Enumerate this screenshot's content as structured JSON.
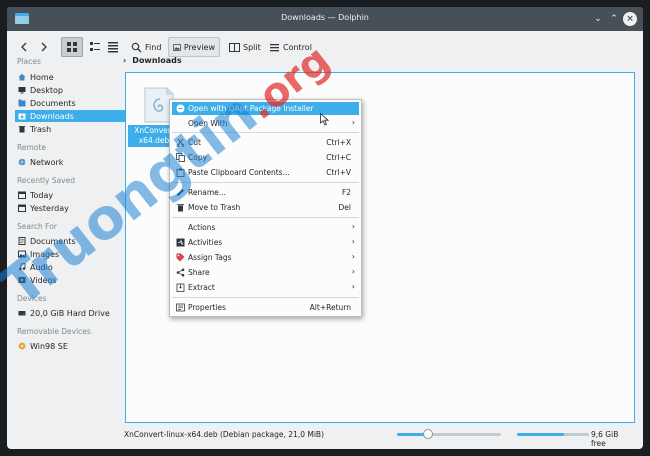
{
  "window": {
    "title": "Downloads — Dolphin"
  },
  "titlebar": {
    "minimize_glyph": "⌄",
    "maximize_glyph": "⌃",
    "close_glyph": "×"
  },
  "toolbar": {
    "find_label": "Find",
    "preview_label": "Preview",
    "split_label": "Split",
    "control_label": "Control"
  },
  "sidebar": {
    "places_header": "Places",
    "places": [
      {
        "label": "Home",
        "icon": "home-icon"
      },
      {
        "label": "Desktop",
        "icon": "desktop-icon"
      },
      {
        "label": "Documents",
        "icon": "documents-icon"
      },
      {
        "label": "Downloads",
        "icon": "downloads-icon"
      },
      {
        "label": "Trash",
        "icon": "trash-icon"
      }
    ],
    "remote_header": "Remote",
    "remote": [
      {
        "label": "Network",
        "icon": "network-icon"
      }
    ],
    "recent_header": "Recently Saved",
    "recent": [
      {
        "label": "Today",
        "icon": "calendar-icon"
      },
      {
        "label": "Yesterday",
        "icon": "calendar-icon"
      }
    ],
    "search_header": "Search For",
    "search": [
      {
        "label": "Documents",
        "icon": "documents-icon"
      },
      {
        "label": "Images",
        "icon": "images-icon"
      },
      {
        "label": "Audio",
        "icon": "audio-icon"
      },
      {
        "label": "Videos",
        "icon": "videos-icon"
      }
    ],
    "devices_header": "Devices",
    "devices": [
      {
        "label": "20,0 GiB Hard Drive",
        "icon": "hard-drive-icon"
      }
    ],
    "removable_header": "Removable Devices",
    "removable": [
      {
        "label": "Win98 SE",
        "icon": "optical-disc-icon"
      }
    ]
  },
  "breadcrumb": {
    "separator": "›",
    "current": "Downloads"
  },
  "file": {
    "name_line1": "XnConvert",
    "name_line2": "x64.deb"
  },
  "context_menu": {
    "items": [
      {
        "label": "Open with QApt Package Installer",
        "shortcut": "",
        "submenu": false
      },
      {
        "label": "Open With",
        "shortcut": "",
        "submenu": true
      },
      {
        "label": "Cut",
        "shortcut": "Ctrl+X",
        "submenu": false
      },
      {
        "label": "Copy",
        "shortcut": "Ctrl+C",
        "submenu": false
      },
      {
        "label": "Paste Clipboard Contents...",
        "shortcut": "Ctrl+V",
        "submenu": false
      },
      {
        "label": "Rename...",
        "shortcut": "F2",
        "submenu": false
      },
      {
        "label": "Move to Trash",
        "shortcut": "Del",
        "submenu": false
      },
      {
        "label": "Actions",
        "shortcut": "",
        "submenu": true
      },
      {
        "label": "Activities",
        "shortcut": "",
        "submenu": true
      },
      {
        "label": "Assign Tags",
        "shortcut": "",
        "submenu": true
      },
      {
        "label": "Share",
        "shortcut": "",
        "submenu": true
      },
      {
        "label": "Extract",
        "shortcut": "",
        "submenu": true
      },
      {
        "label": "Properties",
        "shortcut": "Alt+Return",
        "submenu": false
      }
    ],
    "submenu_arrow": "›"
  },
  "statusbar": {
    "text": "XnConvert-linux-x64.deb (Debian package, 21,0 MiB)",
    "zoom_level": 0.3,
    "disk_used_fraction": 0.65,
    "free_space": "9,6 GiB free"
  },
  "watermark": {
    "text": "Truongtin",
    "suffix": ".org"
  },
  "colors": {
    "accent": "#3daee9",
    "titlebar": "#475057",
    "window_bg": "#eff0f1",
    "view_bg": "#fcfcfc"
  }
}
